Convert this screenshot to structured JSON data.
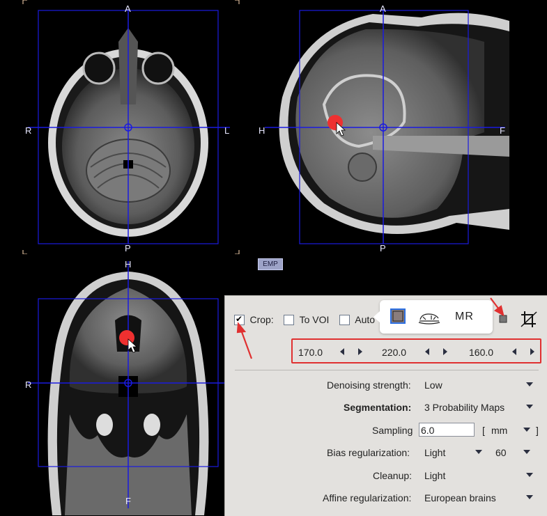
{
  "viewports": {
    "axial": {
      "top": "A",
      "bottom": "P",
      "left": "R",
      "right": "L"
    },
    "sagittal": {
      "top": "A",
      "bottom": "P",
      "left": "H",
      "right": "F"
    },
    "coronal": {
      "top": "H",
      "bottom": "F",
      "left": "R",
      "right": ""
    }
  },
  "emp_button": "EMP",
  "crop": {
    "crop_label": "Crop:",
    "crop_checked": true,
    "to_voi_label": "To VOI",
    "to_voi_checked": false,
    "auto_label": "Auto",
    "auto_checked": false,
    "popup_icons": [
      "box-icon",
      "brain-sagittal-icon",
      "mr-icon"
    ],
    "mr_label": "MR",
    "coords": [
      "170.0",
      "220.0",
      "160.0"
    ]
  },
  "settings": {
    "denoising_label": "Denoising strength:",
    "denoising_value": "Low",
    "segmentation_label": "Segmentation:",
    "segmentation_value": "3 Probability Maps",
    "sampling_label": "Sampling",
    "sampling_value": "6.0",
    "sampling_open": "[",
    "sampling_unit": "mm",
    "sampling_close": "]",
    "bias_label": "Bias regularization:",
    "bias_value": "Light",
    "bias_fwhm": "60",
    "cleanup_label": "Cleanup:",
    "cleanup_value": "Light",
    "affine_label": "Affine regularization:",
    "affine_value": "European brains"
  },
  "colors": {
    "crosshair": "#1a1ae0",
    "highlight": "#e03030",
    "panel_bg": "#e3e1de",
    "marker": "#ee3030"
  }
}
